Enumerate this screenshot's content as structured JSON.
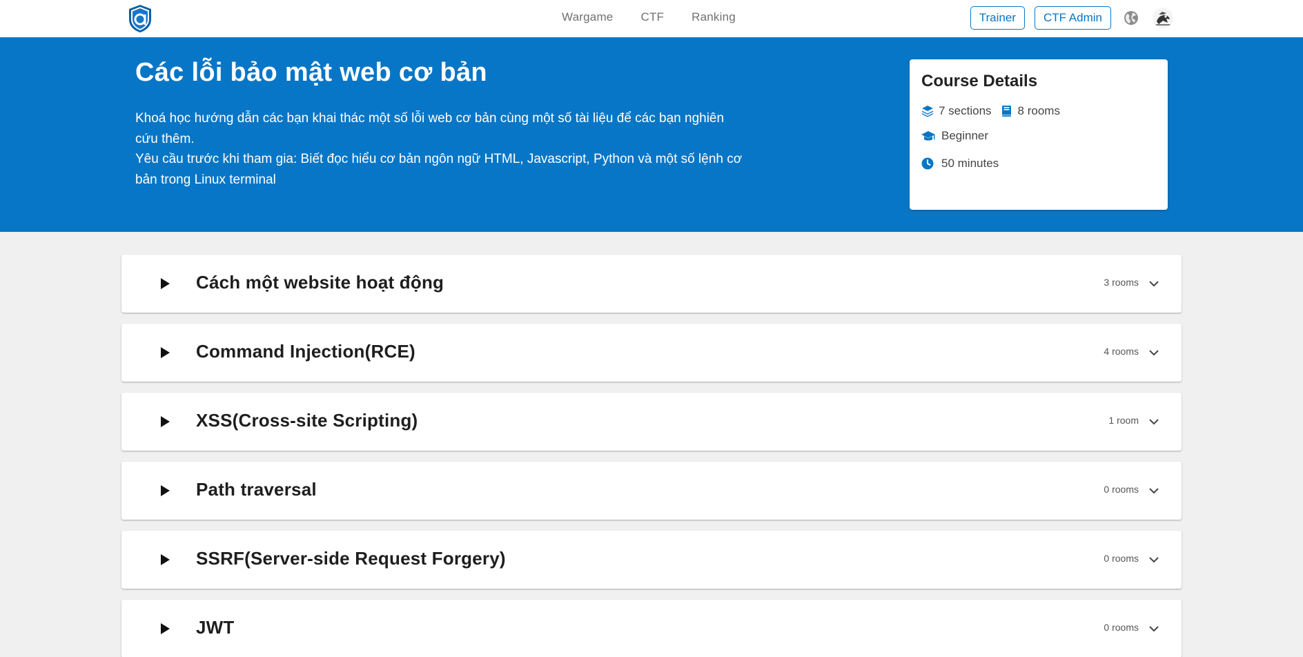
{
  "nav": {
    "links": [
      "Wargame",
      "CTF",
      "Ranking"
    ],
    "trainer_label": "Trainer",
    "ctf_admin_label": "CTF Admin"
  },
  "hero": {
    "title": "Các lỗi bảo mật web cơ bản",
    "description_line1": "Khoá học hướng dẫn các bạn khai thác một số lỗi web cơ bản cùng một số tài liệu để các bạn nghiên cứu thêm.",
    "description_line2": "Yêu cầu trước khi tham gia: Biết đọc hiểu cơ bản ngôn ngữ HTML, Javascript, Python và một số lệnh cơ bản trong Linux terminal"
  },
  "course_details": {
    "title": "Course Details",
    "sections": "7 sections",
    "rooms": "8 rooms",
    "level": "Beginner",
    "duration": "50 minutes"
  },
  "sections": [
    {
      "title": "Cách một website hoạt động",
      "rooms": "3 rooms"
    },
    {
      "title": "Command Injection(RCE)",
      "rooms": "4 rooms"
    },
    {
      "title": "XSS(Cross-site Scripting)",
      "rooms": "1 room"
    },
    {
      "title": "Path traversal",
      "rooms": "0 rooms"
    },
    {
      "title": "SSRF(Server-side Request Forgery)",
      "rooms": "0 rooms"
    },
    {
      "title": "JWT",
      "rooms": "0 rooms"
    }
  ],
  "colors": {
    "brand": "#0876c6",
    "background": "#f0f0f0"
  }
}
